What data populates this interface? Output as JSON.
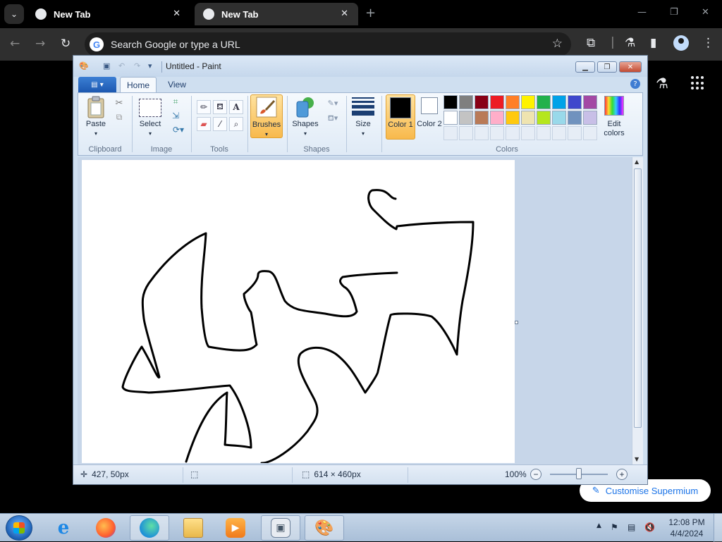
{
  "browser": {
    "tabs": [
      {
        "label": "New Tab",
        "active": false
      },
      {
        "label": "New Tab",
        "active": true
      }
    ],
    "omnibox_placeholder": "Search Google or type a URL",
    "customise_button": "Customise Supermium"
  },
  "paint": {
    "title": "Untitled - Paint",
    "ribbon_tabs": [
      "Home",
      "View"
    ],
    "groups": {
      "clipboard": {
        "label": "Clipboard",
        "paste": "Paste"
      },
      "image": {
        "label": "Image",
        "select": "Select"
      },
      "tools": {
        "label": "Tools"
      },
      "brushes": {
        "label": "Brushes"
      },
      "shapes": {
        "label": "Shapes",
        "shapes_button": "Shapes"
      },
      "size": {
        "label": "Size"
      },
      "colors": {
        "label": "Colors",
        "color1": "Color 1",
        "color1_num": "1",
        "color1_value": "#000000",
        "color2": "Color 2",
        "color2_num": "2",
        "color2_value": "#ffffff",
        "edit_colors": "Edit colors",
        "palette_row1": [
          "#000000",
          "#7f7f7f",
          "#880015",
          "#ed1c24",
          "#ff7f27",
          "#fff200",
          "#22b14c",
          "#00a2e8",
          "#3f48cc",
          "#a349a4"
        ],
        "palette_row2": [
          "#ffffff",
          "#c3c3c3",
          "#b97a57",
          "#ffaec9",
          "#ffc90e",
          "#efe4b0",
          "#b5e61d",
          "#99d9ea",
          "#7092be",
          "#c8bfe7"
        ]
      }
    },
    "status": {
      "cursor_position": "427, 50px",
      "canvas_size": "614 × 460px",
      "zoom": "100%"
    }
  },
  "taskbar": {
    "time": "12:08 PM",
    "date": "4/4/2024",
    "apps": [
      "internet-explorer",
      "firefox",
      "edge",
      "file-explorer",
      "media-player",
      "app-window",
      "paint"
    ]
  }
}
